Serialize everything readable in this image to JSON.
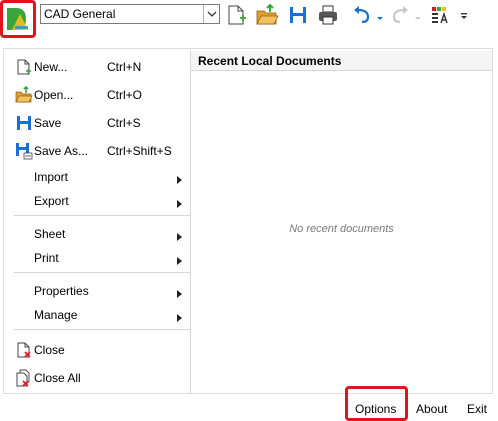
{
  "toolbar": {
    "workspace": "CAD General",
    "icons": [
      "new-icon",
      "open-icon",
      "save-icon",
      "print-icon",
      "undo-icon",
      "redo-icon",
      "properties-icon",
      "customize-icon"
    ]
  },
  "menu": {
    "items": [
      {
        "label": "New...",
        "shortcut": "Ctrl+N",
        "icon": "new-document-icon"
      },
      {
        "label": "Open...",
        "shortcut": "Ctrl+O",
        "icon": "open-folder-icon"
      },
      {
        "label": "Save",
        "shortcut": "Ctrl+S",
        "icon": "save-icon"
      },
      {
        "label": "Save As...",
        "shortcut": "Ctrl+Shift+S",
        "icon": "save-as-icon"
      },
      {
        "label": "Import",
        "submenu": true
      },
      {
        "label": "Export",
        "submenu": true
      },
      {
        "label": "Sheet",
        "submenu": true
      },
      {
        "label": "Print",
        "submenu": true
      },
      {
        "label": "Properties",
        "submenu": true
      },
      {
        "label": "Manage",
        "submenu": true
      },
      {
        "label": "Close",
        "icon": "close-document-icon"
      },
      {
        "label": "Close All",
        "icon": "close-all-icon"
      }
    ]
  },
  "recent": {
    "header": "Recent Local Documents",
    "empty_text": "No recent documents"
  },
  "bottom": {
    "options": "Options",
    "about": "About",
    "exit": "Exit"
  },
  "colors": {
    "highlight": "#e0141c",
    "save_blue": "#1a6fd0",
    "folder_orange": "#e0a030",
    "plus_green": "#3aa53a"
  }
}
